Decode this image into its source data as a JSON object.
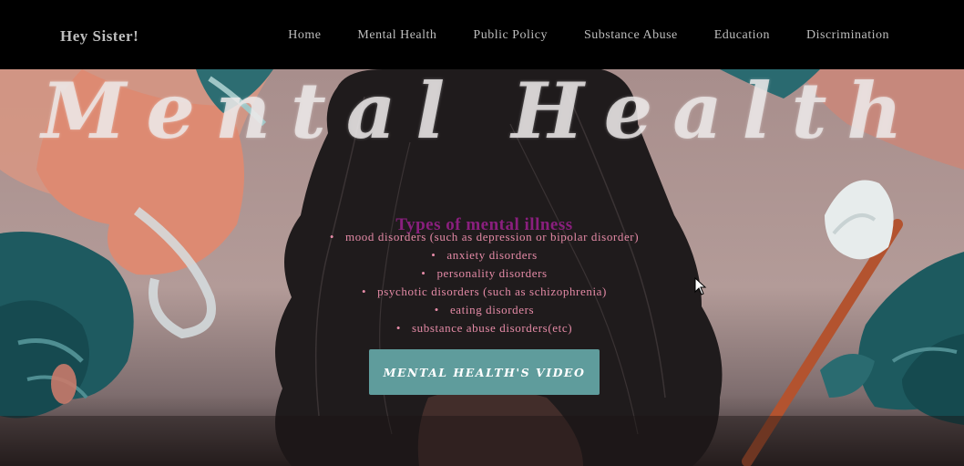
{
  "nav": {
    "brand": "Hey Sister!",
    "links": [
      "Home",
      "Mental Health",
      "Public Policy",
      "Substance Abuse",
      "Education",
      "Discrimination"
    ]
  },
  "hero": {
    "title": "Mental Health",
    "section_heading": "Types of mental illness",
    "illnesses": [
      "mood disorders (such as depression or bipolar disorder)",
      "anxiety disorders",
      "personality disorders",
      "psychotic disorders (such as schizophrenia)",
      "eating disorders",
      "substance abuse disorders(etc)"
    ],
    "button_label": "MENTAL HEALTH'S VIDEO"
  },
  "colors": {
    "nav_background": "#000000",
    "heading": "#8a1f7e",
    "list_text": "#e48aa6",
    "button": "#5f9c9c",
    "hair": "#1f1b1c",
    "teal_leaves": "#1e5a60",
    "brush_handle": "#b3532f"
  },
  "icons": [
    "mouse-pointer-icon"
  ]
}
